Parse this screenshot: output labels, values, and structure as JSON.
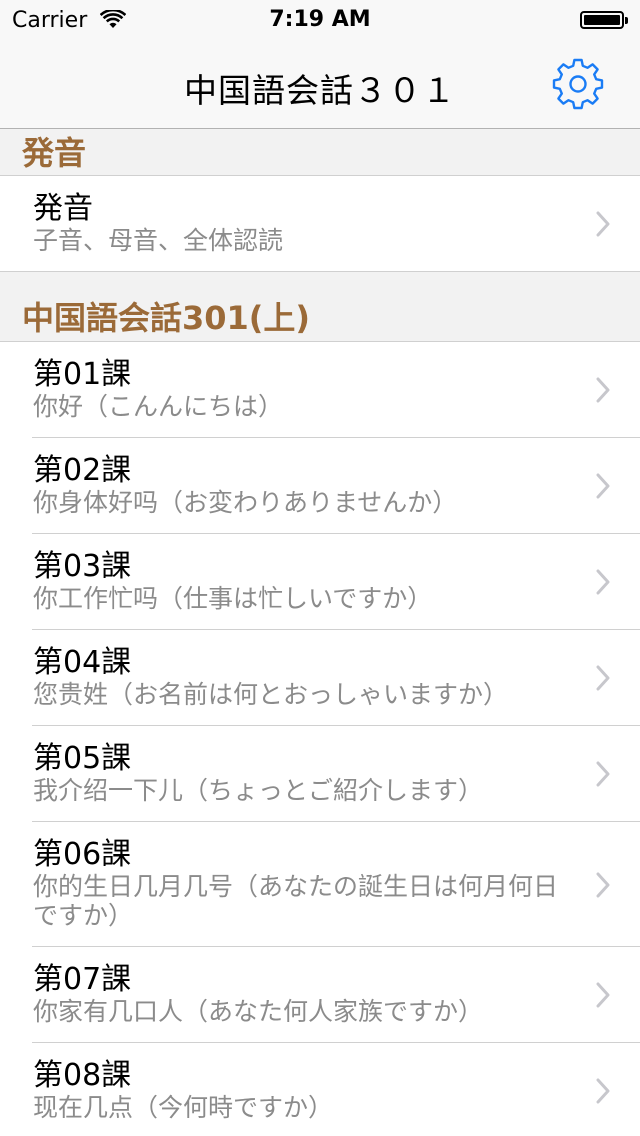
{
  "status": {
    "carrier": "Carrier",
    "time": "7:19 AM"
  },
  "nav": {
    "title": "中国語会話３０１"
  },
  "sections": [
    {
      "header": "発音",
      "rows": [
        {
          "title": "発音",
          "subtitle": "子音、母音、全体認読"
        }
      ]
    },
    {
      "header": "中国語会話301(上)",
      "rows": [
        {
          "title": "第01課",
          "subtitle": "你好（こんんにちは）"
        },
        {
          "title": "第02課",
          "subtitle": "你身体好吗（お変わりありませんか）"
        },
        {
          "title": "第03課",
          "subtitle": "你工作忙吗（仕事は忙しいですか）"
        },
        {
          "title": "第04課",
          "subtitle": "您贵姓（お名前は何とおっしゃいますか）"
        },
        {
          "title": "第05課",
          "subtitle": "我介绍一下儿（ちょっとご紹介します）"
        },
        {
          "title": "第06課",
          "subtitle": "你的生日几月几号（あなたの誕生日は何月何日ですか）"
        },
        {
          "title": "第07課",
          "subtitle": "你家有几口人（あなた何人家族ですか）"
        },
        {
          "title": "第08課",
          "subtitle": "现在几点（今何時ですか）"
        }
      ]
    }
  ],
  "colors": {
    "accent": "#1a7cf5",
    "section_text": "#9b6a38",
    "subtitle": "#8b8b8b"
  }
}
